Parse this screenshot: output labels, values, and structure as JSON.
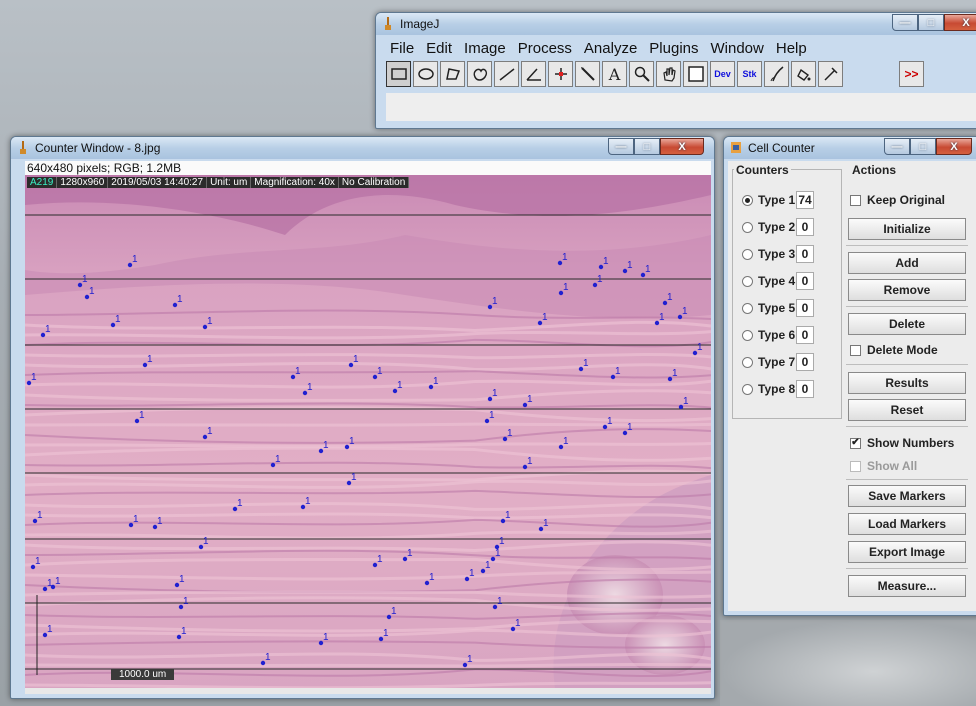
{
  "imagej": {
    "title": "ImageJ",
    "menus": [
      "File",
      "Edit",
      "Image",
      "Process",
      "Analyze",
      "Plugins",
      "Window",
      "Help"
    ],
    "tools": [
      {
        "icon": "rectangle-icon"
      },
      {
        "icon": "oval-icon"
      },
      {
        "icon": "polygon-icon"
      },
      {
        "icon": "freehand-icon"
      },
      {
        "icon": "line-icon"
      },
      {
        "icon": "angle-icon"
      },
      {
        "icon": "point-icon"
      },
      {
        "icon": "wand-icon"
      },
      {
        "icon": "text-icon",
        "glyph": "A"
      },
      {
        "icon": "magnifier-icon"
      },
      {
        "icon": "hand-icon"
      },
      {
        "icon": "color-picker-icon"
      },
      {
        "icon": "dev-menu-icon",
        "label": "Dev"
      },
      {
        "icon": "stack-menu-icon",
        "label": "Stk"
      },
      {
        "icon": "brush-icon"
      },
      {
        "icon": "flood-icon"
      },
      {
        "icon": "pen-icon"
      },
      {
        "icon": "blank-tool-icon"
      },
      {
        "icon": "blank-tool-icon"
      },
      {
        "icon": "more-tools-icon",
        "label": ">>"
      }
    ]
  },
  "counter_window": {
    "title": "Counter Window - 8.jpg",
    "info": "640x480 pixels; RGB; 1.2MB",
    "overlay": [
      "A219",
      "1280x960",
      "2019/05/03 14:40:27",
      "Unit: um",
      "Magnification:  40x",
      "No Calibration"
    ],
    "scale_bar": "1000.0 um",
    "marker_label": "1"
  },
  "cell_counter": {
    "title": "Cell Counter",
    "counters_title": "Counters",
    "actions_title": "Actions",
    "counters": [
      {
        "label": "Type 1",
        "count": "74",
        "selected": true
      },
      {
        "label": "Type 2",
        "count": "0",
        "selected": false
      },
      {
        "label": "Type 3",
        "count": "0",
        "selected": false
      },
      {
        "label": "Type 4",
        "count": "0",
        "selected": false
      },
      {
        "label": "Type 5",
        "count": "0",
        "selected": false
      },
      {
        "label": "Type 6",
        "count": "0",
        "selected": false
      },
      {
        "label": "Type 7",
        "count": "0",
        "selected": false
      },
      {
        "label": "Type 8",
        "count": "0",
        "selected": false
      }
    ],
    "keep_original": "Keep Original",
    "initialize": "Initialize",
    "add": "Add",
    "remove": "Remove",
    "delete": "Delete",
    "delete_mode": "Delete Mode",
    "results": "Results",
    "reset": "Reset",
    "show_numbers": "Show Numbers",
    "show_all": "Show All",
    "save_markers": "Save Markers",
    "load_markers": "Load Markers",
    "export_image": "Export Image",
    "measure": "Measure..."
  },
  "colors": {
    "marker": "#2020d0",
    "tissue": "#d7a2c2",
    "accent": "#39f0c4"
  }
}
